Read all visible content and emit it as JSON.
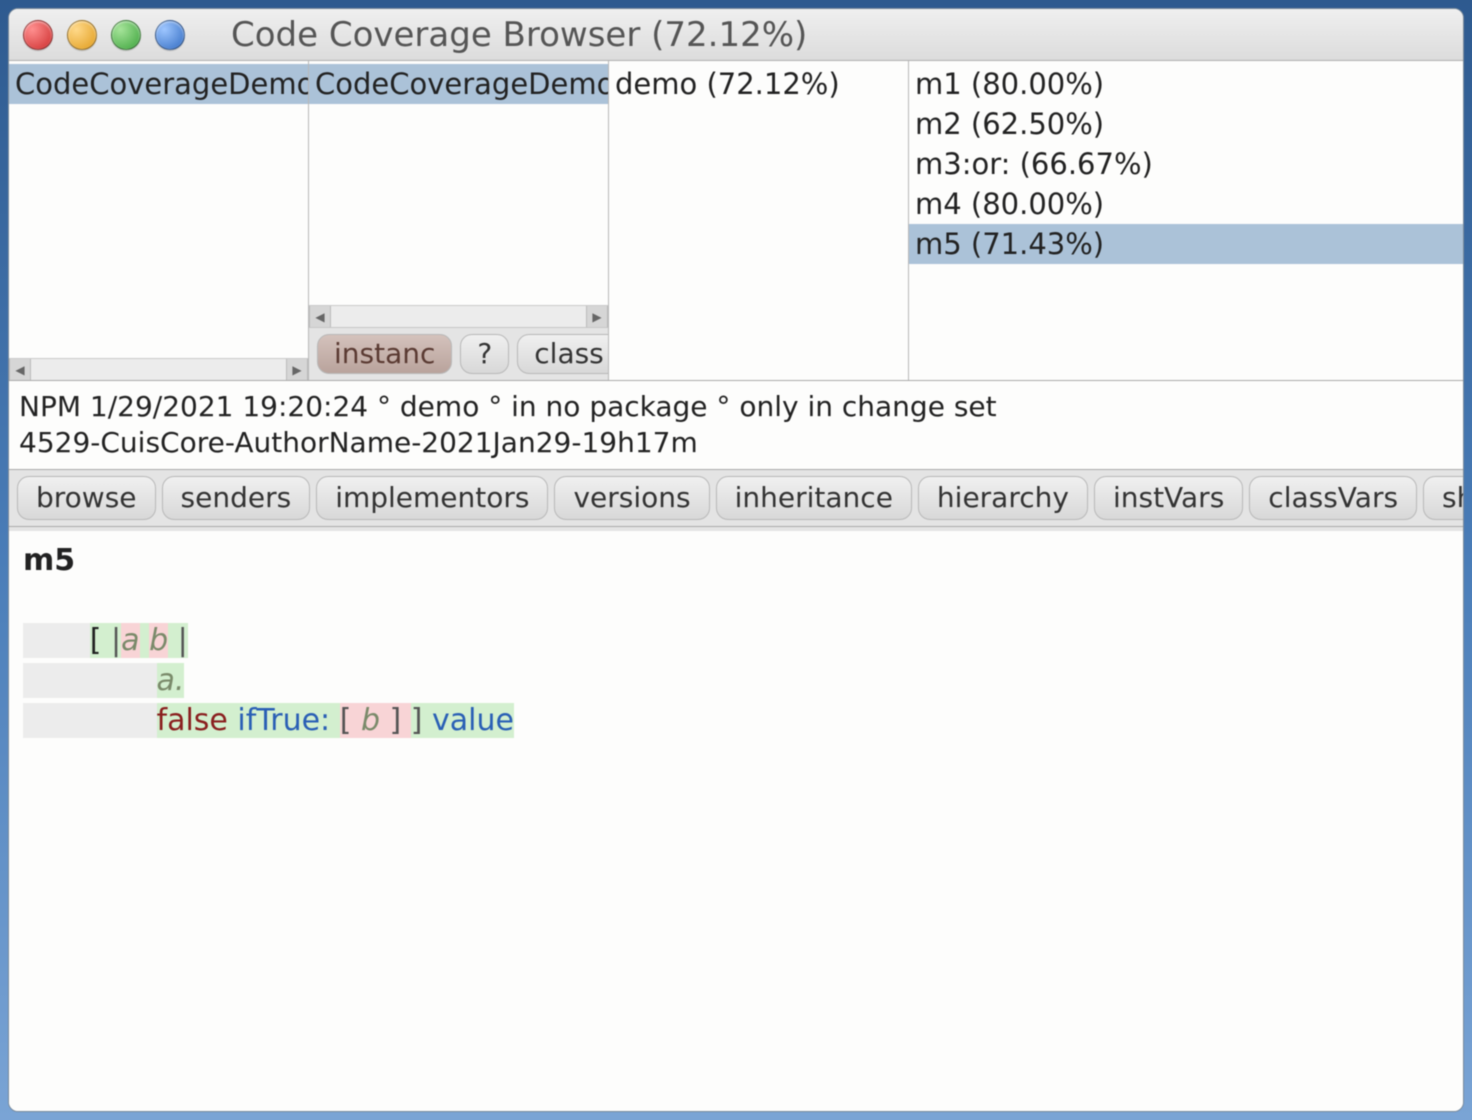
{
  "window": {
    "title": "Code Coverage Browser (72.12%)"
  },
  "panes": {
    "packages": [
      {
        "label": "CodeCoverageDemo",
        "selected": true
      }
    ],
    "classes": [
      {
        "label": "CodeCoverageDemo",
        "selected": true
      }
    ],
    "categories": [
      {
        "label": "demo (72.12%)",
        "selected": false
      }
    ],
    "methods": [
      {
        "label": "m1 (80.00%)",
        "selected": false
      },
      {
        "label": "m2 (62.50%)",
        "selected": false
      },
      {
        "label": "m3:or: (66.67%)",
        "selected": false
      },
      {
        "label": "m4 (80.00%)",
        "selected": false
      },
      {
        "label": "m5 (71.43%)",
        "selected": true
      }
    ]
  },
  "classSwitch": {
    "instance": "instanc",
    "help": "?",
    "class": "class"
  },
  "info": {
    "line1": "NPM 1/29/2021 19:20:24 ° demo ° in no package ° only in change set",
    "line2": "4529-CuisCore-AuthorName-2021Jan29-19h17m"
  },
  "buttons": {
    "browse": "browse",
    "senders": "senders",
    "implementors": "implementors",
    "versions": "versions",
    "inheritance": "inheritance",
    "hierarchy": "hierarchy",
    "instVars": "instVars",
    "classVars": "classVars",
    "show": "show..."
  },
  "code": {
    "methodName": "m5",
    "tokens": {
      "openBlock": "[ ",
      "pipe1": "|",
      "a": "a",
      "sp": " ",
      "b": "b",
      "pipe2": " |",
      "aDot": "a.",
      "false": "false",
      "ifTrue": " ifTrue: ",
      "innerOpen": "[ ",
      "innerClose": " ] ",
      "closeBlock": "]",
      "value": " value"
    }
  }
}
